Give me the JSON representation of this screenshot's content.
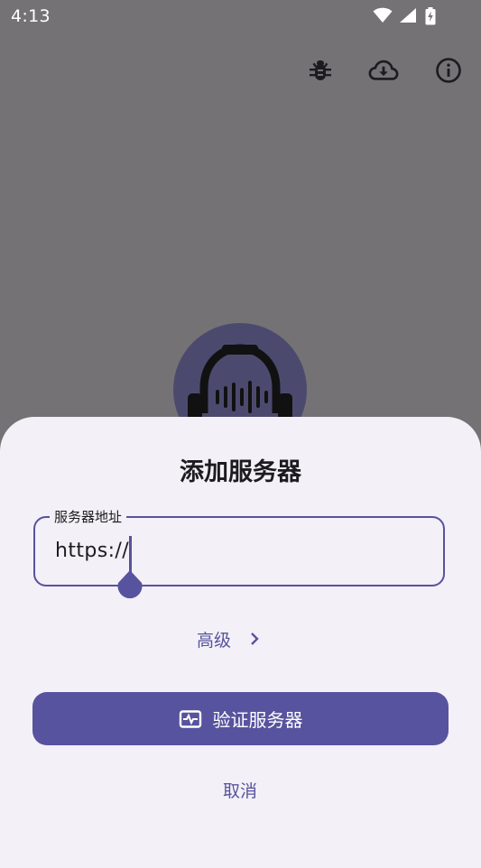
{
  "status_bar": {
    "time": "4:13",
    "icons": [
      "wifi-icon",
      "signal-icon",
      "battery-charging-icon"
    ]
  },
  "toolbar": {
    "icons": [
      "bug-icon",
      "cloud-download-icon",
      "info-icon"
    ]
  },
  "logo": {
    "icon": "headphones-waveform-icon"
  },
  "dialog": {
    "title": "添加服务器",
    "server_field": {
      "label": "服务器地址",
      "value": "https://"
    },
    "advanced_label": "高级",
    "verify_button_label": "验证服务器",
    "cancel_label": "取消"
  },
  "colors": {
    "accent": "#57539e",
    "sheet_background": "#f3f0f7",
    "scrim": "#747274"
  }
}
